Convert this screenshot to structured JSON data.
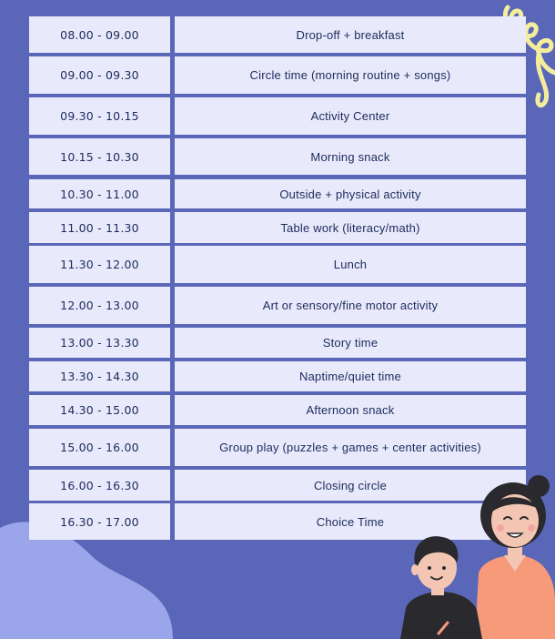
{
  "schedule": [
    {
      "time": "08.00 - 09.00",
      "activity": "Drop-off + breakfast"
    },
    {
      "time": "09.00 - 09.30",
      "activity": "Circle time (morning routine + songs)"
    },
    {
      "time": "09.30 - 10.15",
      "activity": "Activity Center"
    },
    {
      "time": "10.15 - 10.30",
      "activity": "Morning snack"
    },
    {
      "time": "10.30 - 11.00",
      "activity": "Outside + physical activity"
    },
    {
      "time": "11.00 - 11.30",
      "activity": "Table work (literacy/math)"
    },
    {
      "time": "11.30 - 12.00",
      "activity": "Lunch"
    },
    {
      "time": "12.00 - 13.00",
      "activity": "Art or sensory/fine motor activity"
    },
    {
      "time": "13.00 - 13.30",
      "activity": "Story time"
    },
    {
      "time": "13.30 - 14.30",
      "activity": "Naptime/quiet time"
    },
    {
      "time": "14.30 - 15.00",
      "activity": "Afternoon snack"
    },
    {
      "time": "15.00 - 16.00",
      "activity": "Group play (puzzles + games + center activities)"
    },
    {
      "time": "16.00 - 16.30",
      "activity": "Closing circle"
    },
    {
      "time": "16.30 - 17.00",
      "activity": "Choice Time"
    }
  ],
  "colors": {
    "background": "#5a66b8",
    "cell": "#e8eafb",
    "text": "#1d2a5c",
    "blob": "#9ba6ea",
    "squiggle": "#f4ee9c",
    "teacher_shirt": "#f79a7a",
    "child_shirt": "#2a2a2e"
  },
  "illustrations": [
    "teacher-icon",
    "child-icon",
    "squiggle-decoration",
    "corner-blob"
  ]
}
